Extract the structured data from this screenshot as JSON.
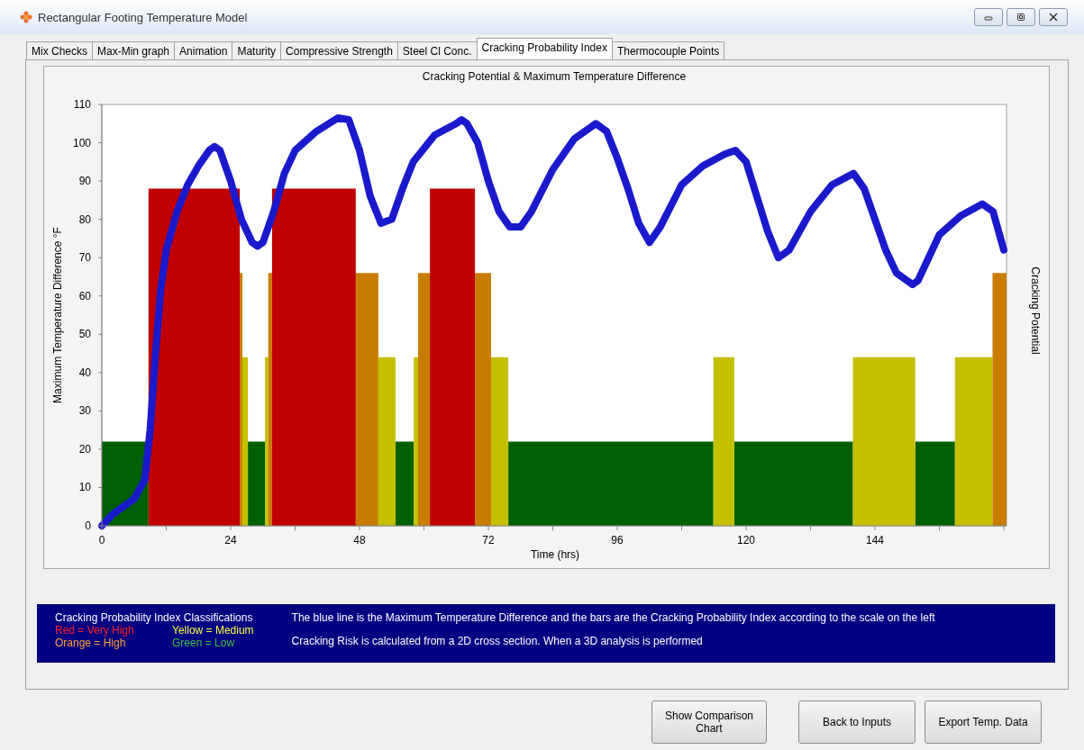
{
  "window": {
    "title": "Rectangular Footing Temperature Model"
  },
  "tabs": [
    {
      "label": "Mix Checks",
      "selected": false
    },
    {
      "label": "Max-Min graph",
      "selected": false
    },
    {
      "label": "Animation",
      "selected": false
    },
    {
      "label": "Maturity",
      "selected": false
    },
    {
      "label": "Compressive Strength",
      "selected": false
    },
    {
      "label": "Steel Cl Conc.",
      "selected": false
    },
    {
      "label": "Cracking Probability Index",
      "selected": true
    },
    {
      "label": "Thermocouple Points",
      "selected": false
    }
  ],
  "chart": {
    "chart_data": {
      "type": "line",
      "title": "Cracking Potential & Maximum Temperature Difference",
      "xlabel": "Time (hrs)",
      "ylabel": "Maximum Temperature Difference °F",
      "y2label": "Cracking Potential",
      "xlim": [
        0,
        168.5
      ],
      "ylim": [
        0,
        110
      ],
      "xticks": [
        0,
        24,
        48,
        72,
        96,
        120,
        144
      ],
      "yticks": [
        0,
        10,
        20,
        30,
        40,
        50,
        60,
        70,
        80,
        90,
        100,
        110
      ],
      "series": [
        {
          "type": "area",
          "color": "#005f00",
          "x": [
            0,
            8.7,
            8.7,
            27.2,
            27.2,
            30.4,
            30.4,
            54.7,
            54.7,
            58.1,
            58.1,
            75.7,
            75.7,
            113.9,
            113.9,
            117.8,
            117.8,
            139.9,
            139.9,
            151.5,
            151.5,
            158.9,
            158.9
          ],
          "values": [
            22,
            22,
            0,
            0,
            22,
            22,
            0,
            0,
            22,
            22,
            0,
            0,
            22,
            22,
            0,
            0,
            22,
            22,
            0,
            0,
            22,
            22,
            0
          ]
        },
        {
          "type": "area",
          "color": "#c3c000",
          "x": [
            26.2,
            26.2,
            27.2,
            27.2,
            30.4,
            30.4,
            31.0,
            31.0,
            51.5,
            51.5,
            54.7,
            54.7,
            58.1,
            58.1,
            58.9,
            58.9,
            72.5,
            72.5,
            75.7,
            75.7,
            113.9,
            113.9,
            117.8,
            117.8,
            139.9,
            139.9,
            151.5,
            151.5,
            158.9,
            158.9,
            165.9,
            165.9
          ],
          "values": [
            0,
            44,
            44,
            0,
            0,
            44,
            44,
            0,
            0,
            44,
            44,
            0,
            0,
            44,
            44,
            0,
            0,
            44,
            44,
            0,
            0,
            44,
            44,
            0,
            0,
            44,
            44,
            0,
            0,
            44,
            44,
            0
          ]
        },
        {
          "type": "area",
          "color": "#c87d00",
          "x": [
            25.7,
            25.7,
            26.2,
            26.2,
            31.0,
            31.0,
            31.7,
            31.7,
            47.3,
            47.3,
            51.5,
            51.5,
            58.9,
            58.9,
            61.1,
            61.1,
            69.5,
            69.5,
            72.5,
            72.5,
            165.9,
            165.9,
            168.5,
            168.5
          ],
          "values": [
            0,
            66,
            66,
            0,
            0,
            66,
            66,
            0,
            0,
            66,
            66,
            0,
            0,
            66,
            66,
            0,
            0,
            66,
            66,
            0,
            0,
            66,
            66,
            0
          ]
        },
        {
          "type": "area",
          "color": "#c00000",
          "x": [
            8.7,
            8.7,
            25.7,
            25.7,
            31.7,
            31.7,
            47.3,
            47.3,
            61.1,
            61.1,
            69.5,
            69.5
          ],
          "values": [
            0,
            88,
            88,
            0,
            0,
            88,
            88,
            0,
            0,
            88,
            88,
            0
          ]
        },
        {
          "type": "line",
          "color": "#1a1acc",
          "x": [
            0,
            2,
            4,
            6,
            8,
            9,
            10,
            11,
            12,
            14,
            16,
            18,
            20,
            21,
            22,
            24,
            26,
            28,
            29,
            30,
            32,
            34,
            36,
            40,
            44,
            46,
            48,
            50,
            52,
            54,
            56,
            58,
            62,
            66,
            67,
            68,
            70,
            72,
            74,
            76,
            78,
            80,
            84,
            88,
            92,
            94,
            96,
            98,
            100,
            102,
            104,
            108,
            112,
            116,
            118,
            120,
            122,
            124,
            126,
            128,
            132,
            136,
            140,
            142,
            144,
            146,
            148,
            151,
            152,
            154,
            156,
            160,
            164,
            166,
            168
          ],
          "values": [
            0,
            3,
            5,
            7,
            12,
            25,
            45,
            62,
            72,
            82,
            89,
            94,
            98,
            99,
            98,
            90,
            80,
            74,
            73,
            74,
            82,
            92,
            98,
            103,
            106.5,
            106,
            98,
            86,
            79,
            80,
            88,
            95,
            102,
            105,
            106,
            105,
            100,
            90,
            82,
            78,
            78,
            82,
            93,
            101,
            105,
            103,
            96,
            88,
            79,
            74,
            78,
            89,
            94,
            97,
            98,
            95,
            86,
            77,
            70,
            72,
            82,
            89,
            92,
            88,
            80,
            72,
            66,
            63,
            64,
            70,
            76,
            81,
            84,
            82,
            72
          ]
        }
      ]
    }
  },
  "legend_panel": {
    "heading": "Cracking Probability Index Classifications",
    "classes": [
      {
        "label": "Red = Very High",
        "color": "#ff2020"
      },
      {
        "label": "Yellow = Medium",
        "color": "#ffff40"
      },
      {
        "label": "Orange = High",
        "color": "#ffa030"
      },
      {
        "label": "Green = Low",
        "color": "#40c040"
      }
    ],
    "notes": [
      "The blue line is the Maximum Temperature Difference and the bars are the Cracking Probability Index according to the scale on the left",
      "Cracking Risk is calculated from a 2D cross section. When a 3D analysis is performed"
    ]
  },
  "buttons": [
    "Show Comparison Chart",
    "Back to Inputs",
    "Export Temp. Data"
  ]
}
